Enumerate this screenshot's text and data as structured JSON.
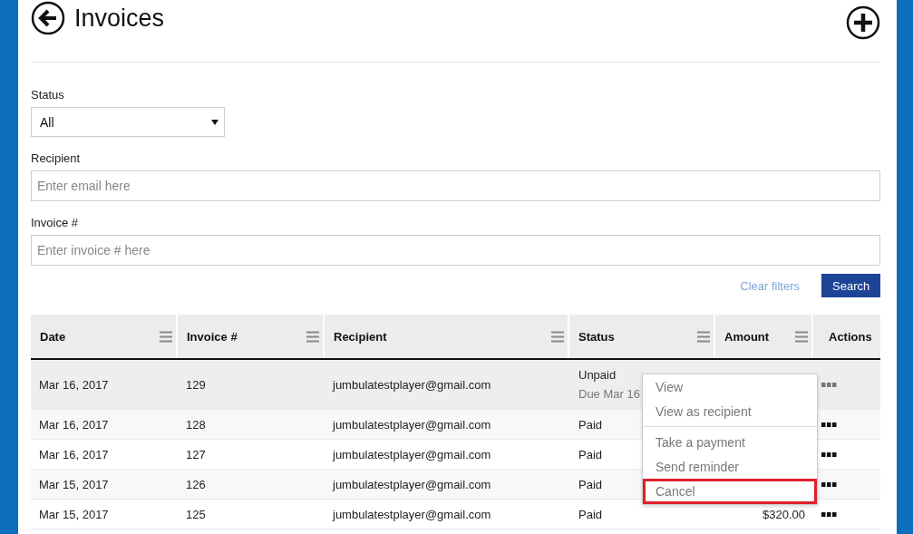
{
  "page": {
    "title": "Invoices"
  },
  "filters": {
    "status": {
      "label": "Status",
      "value": "All"
    },
    "recipient": {
      "label": "Recipient",
      "placeholder": "Enter email here"
    },
    "invoice": {
      "label": "Invoice #",
      "placeholder": "Enter invoice # here"
    },
    "clear": "Clear filters",
    "search": "Search"
  },
  "table": {
    "columns": [
      {
        "label": "Date",
        "has_menu": true
      },
      {
        "label": "Invoice #",
        "has_menu": true
      },
      {
        "label": "Recipient",
        "has_menu": true
      },
      {
        "label": "Status",
        "has_menu": true
      },
      {
        "label": "Amount",
        "has_menu": true
      },
      {
        "label": "Actions",
        "has_menu": false
      }
    ],
    "rows": [
      {
        "date": "Mar 16, 2017",
        "invoice": "129",
        "recipient": "jumbulatestplayer@gmail.com",
        "status": "Unpaid",
        "status_note": "Due Mar 16",
        "selected": true
      },
      {
        "date": "Mar 16, 2017",
        "invoice": "128",
        "recipient": "jumbulatestplayer@gmail.com",
        "status": "Paid",
        "selected": false
      },
      {
        "date": "Mar 16, 2017",
        "invoice": "127",
        "recipient": "jumbulatestplayer@gmail.com",
        "status": "Paid",
        "selected": false
      },
      {
        "date": "Mar 15, 2017",
        "invoice": "126",
        "recipient": "jumbulatestplayer@gmail.com",
        "status": "Paid",
        "selected": false
      },
      {
        "date": "Mar 15, 2017",
        "invoice": "125",
        "recipient": "jumbulatestplayer@gmail.com",
        "status": "Paid",
        "amount": "$320.00",
        "selected": false
      }
    ]
  },
  "actions_menu": {
    "groups": [
      [
        {
          "label": "View",
          "highlighted": false
        },
        {
          "label": "View as recipient",
          "highlighted": false
        }
      ],
      [
        {
          "label": "Take a payment",
          "highlighted": false
        },
        {
          "label": "Send reminder",
          "highlighted": false
        },
        {
          "label": "Cancel",
          "highlighted": true
        }
      ]
    ]
  }
}
